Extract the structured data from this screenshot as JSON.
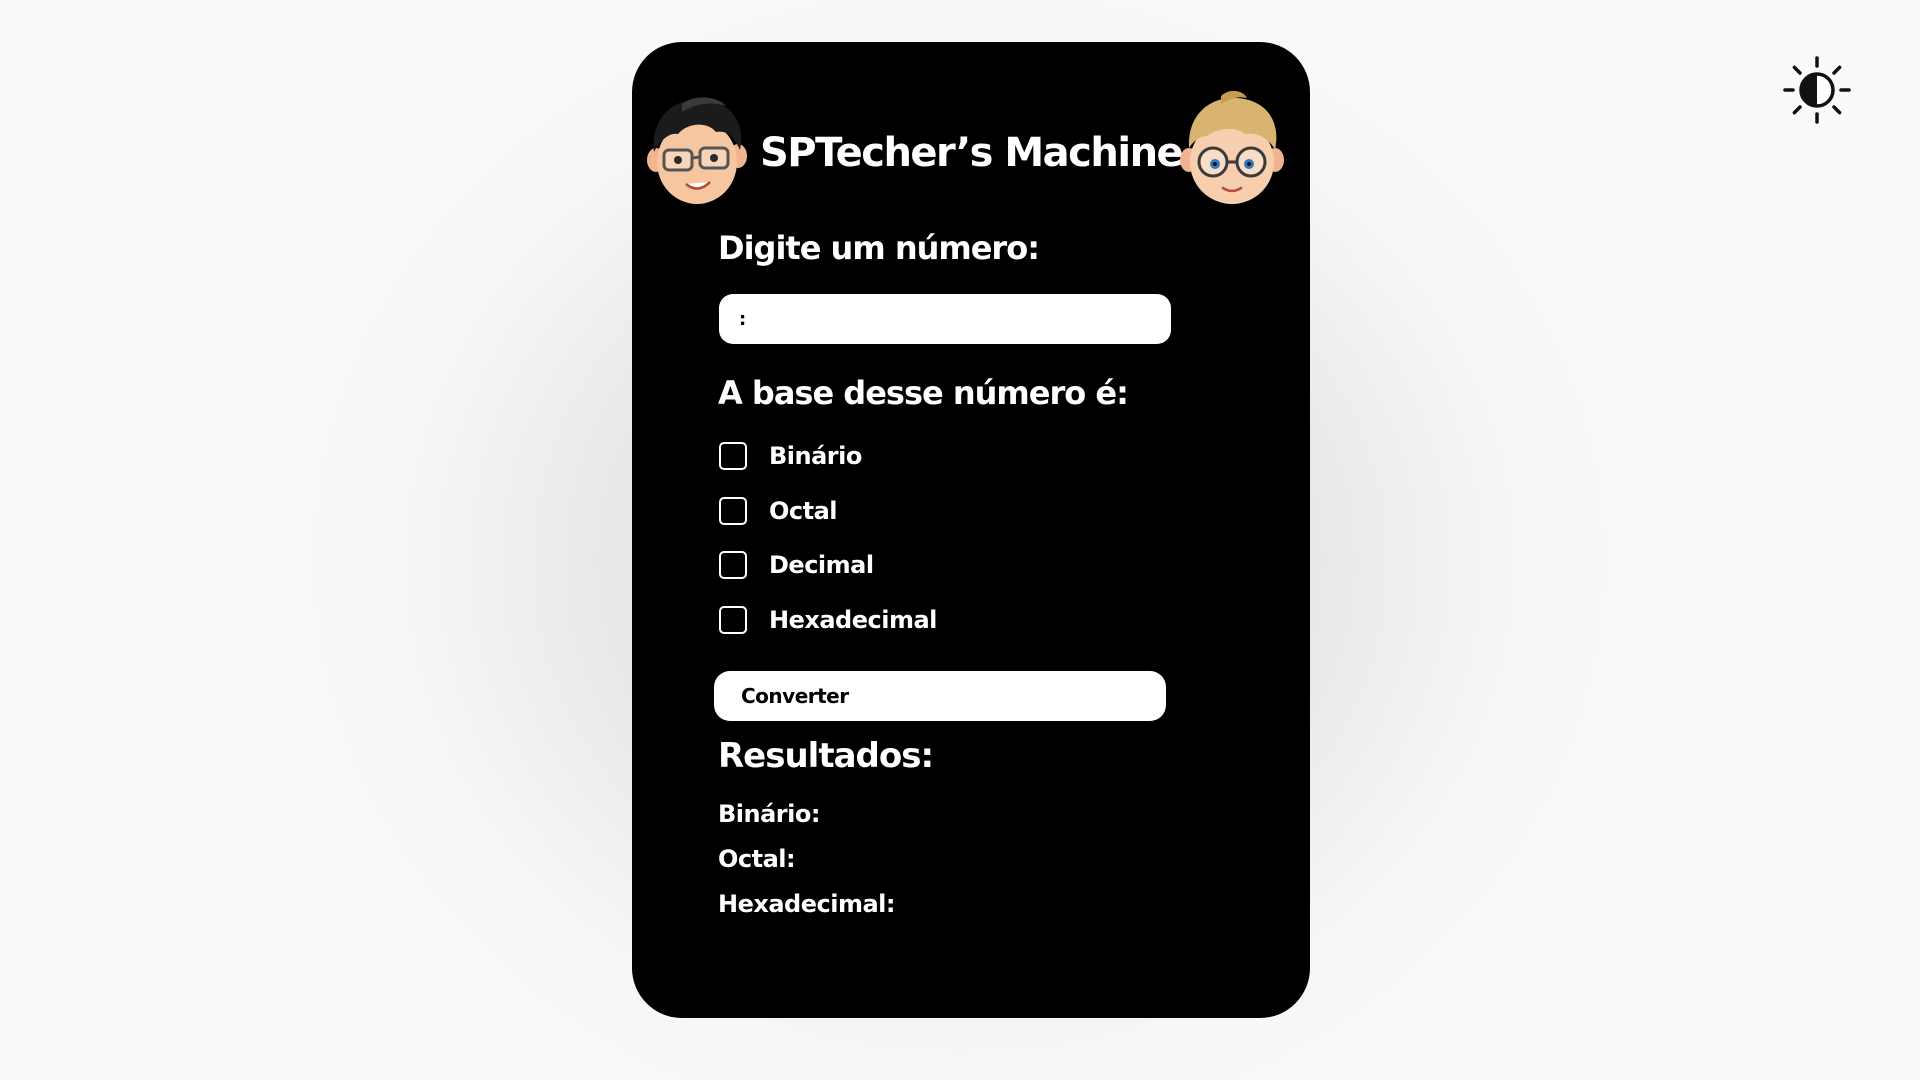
{
  "app": {
    "title": "SPTecher’s Machine"
  },
  "theme_toggle": {
    "icon": "brightness-contrast-icon"
  },
  "avatars": {
    "left": "dark-haired-boy-with-glasses-avatar",
    "right": "blond-boy-with-glasses-avatar"
  },
  "input_section": {
    "label": "Digite um número:",
    "value": ":",
    "placeholder": ""
  },
  "base_section": {
    "label": "A base desse número é:",
    "options": [
      {
        "label": "Binário",
        "checked": false
      },
      {
        "label": "Octal",
        "checked": false
      },
      {
        "label": "Decimal",
        "checked": false
      },
      {
        "label": "Hexadecimal",
        "checked": false
      }
    ]
  },
  "convert_button": {
    "label": "Converter"
  },
  "results": {
    "title": "Resultados:",
    "binary_label": "Binário:",
    "octal_label": "Octal:",
    "hex_label": "Hexadecimal:"
  },
  "colors": {
    "card_background": "#000000",
    "text": "#ffffff",
    "field_background": "#ffffff",
    "page_background": "#e6e6e6"
  }
}
